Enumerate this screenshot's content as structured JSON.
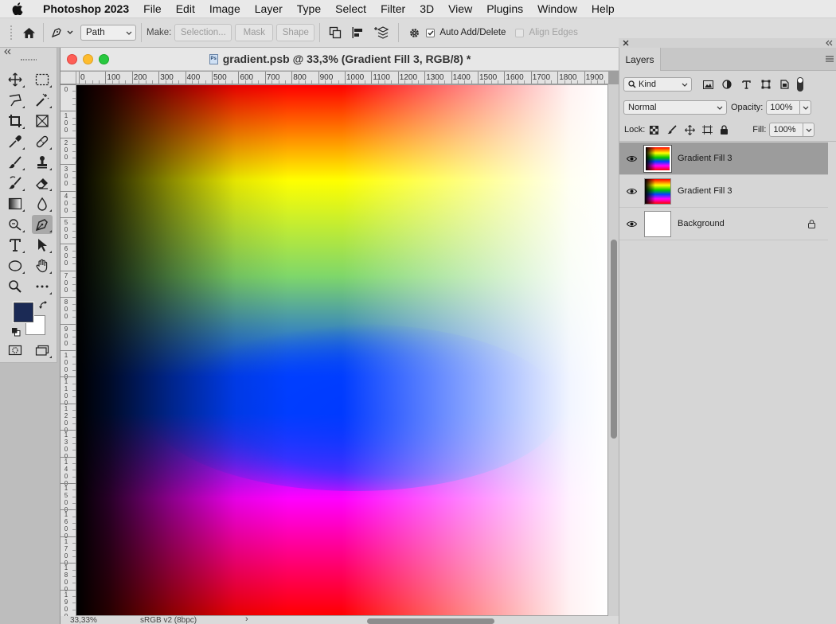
{
  "menubar": {
    "app_name": "Photoshop 2023",
    "items": [
      "File",
      "Edit",
      "Image",
      "Layer",
      "Type",
      "Select",
      "Filter",
      "3D",
      "View",
      "Plugins",
      "Window",
      "Help"
    ]
  },
  "options_bar": {
    "mode_value": "Path",
    "make_label": "Make:",
    "selection_button": "Selection...",
    "mask_button": "Mask",
    "shape_button": "Shape",
    "auto_add_delete_label": "Auto Add/Delete",
    "auto_add_delete_checked": true,
    "align_edges_label": "Align Edges",
    "align_edges_checked": false
  },
  "tools": {
    "foreground_color": "#1b2a55",
    "background_color": "#ffffff",
    "active_tool": "pen-tool"
  },
  "document": {
    "title": "gradient.psb @ 33,3% (Gradient Fill 3, RGB/8) *",
    "file_badge": "Ps",
    "ruler_h_labels": [
      "0",
      "100",
      "200",
      "300",
      "400",
      "500",
      "600",
      "700",
      "800",
      "900",
      "1000",
      "1100",
      "1200",
      "1300",
      "1400",
      "1500",
      "1600",
      "1700",
      "1800",
      "1900"
    ],
    "ruler_v_labels": [
      "0",
      "100",
      "200",
      "300",
      "400",
      "500",
      "600",
      "700",
      "800",
      "900",
      "1000",
      "1100",
      "1200",
      "1300",
      "1400",
      "1500",
      "1600",
      "1700",
      "1800",
      "1900"
    ],
    "zoom": "33,33%",
    "color_profile": "sRGB v2 (8bpc)"
  },
  "layers_panel": {
    "tab_label": "Layers",
    "filter_kind": "Kind",
    "blend_mode": "Normal",
    "opacity_label": "Opacity:",
    "opacity_value": "100%",
    "lock_label": "Lock:",
    "fill_label": "Fill:",
    "fill_value": "100%",
    "layers": [
      {
        "name": "Gradient Fill 3",
        "visible": true,
        "selected": true,
        "locked": false
      },
      {
        "name": "Gradient Fill 3",
        "visible": true,
        "selected": false,
        "locked": false
      },
      {
        "name": "Background",
        "visible": true,
        "selected": false,
        "locked": true
      }
    ]
  }
}
